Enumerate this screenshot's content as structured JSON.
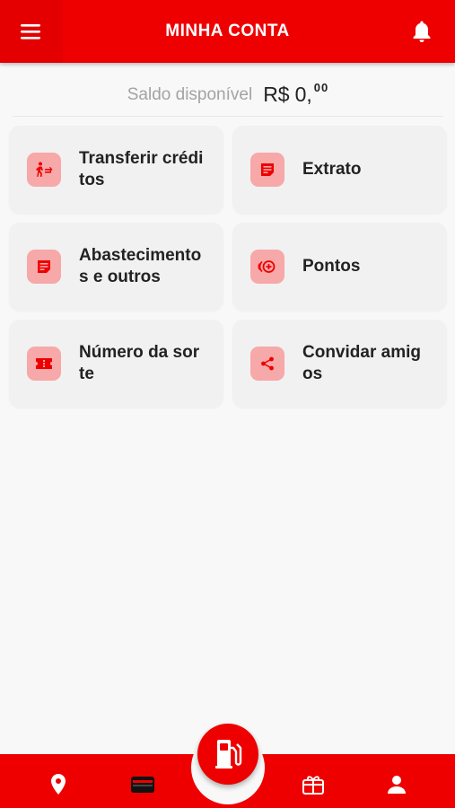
{
  "header": {
    "title": "MINHA CONTA",
    "menu_icon": "hamburger-menu-icon",
    "bell_icon": "bell-icon"
  },
  "balance": {
    "label": "Saldo disponível",
    "currency": "R$",
    "integer": "0,",
    "cents": "00"
  },
  "cards": [
    {
      "label": "Transferir créditos",
      "icon": "transfer-icon"
    },
    {
      "label": "Extrato",
      "icon": "statement-icon"
    },
    {
      "label": "Abastecimentos e outros",
      "icon": "receipt-icon"
    },
    {
      "label": "Pontos",
      "icon": "points-icon"
    },
    {
      "label": "Número da sorte",
      "icon": "ticket-icon"
    },
    {
      "label": "Convidar amigos",
      "icon": "share-icon"
    }
  ],
  "bottom_nav": {
    "items": [
      "location-pin-icon",
      "wallet-icon",
      "gift-icon",
      "person-icon"
    ],
    "center": "fuel-pump-icon"
  },
  "colors": {
    "brand": "#ee0000",
    "icon_tile": "#f7a8a8",
    "card_bg": "#f1f1f1"
  }
}
